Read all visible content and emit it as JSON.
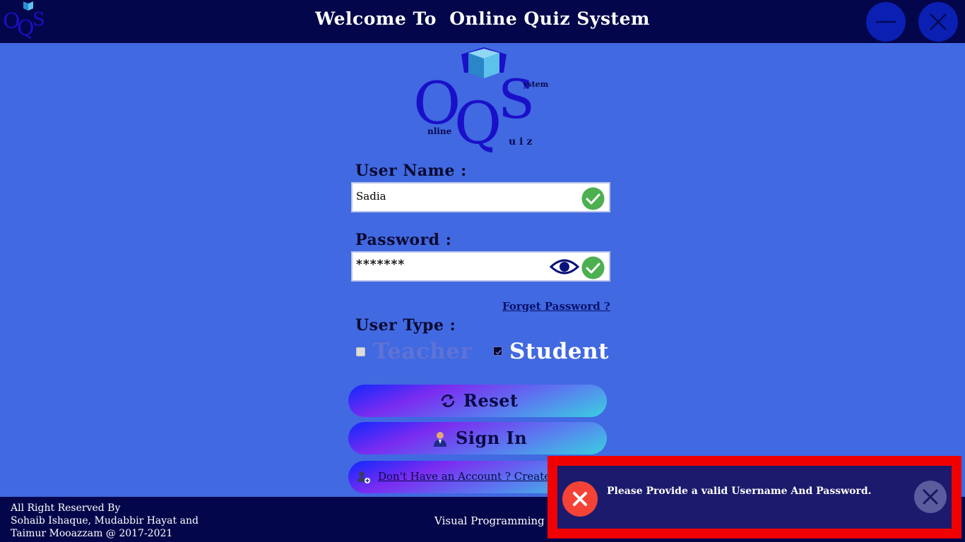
{
  "header": {
    "title": "Welcome To  Online Quiz System",
    "minimize_icon": "minimize-icon",
    "close_icon": "close-icon"
  },
  "logo": {
    "big_letters": [
      "O",
      "Q",
      "S"
    ],
    "nline": "nline",
    "uiz": "uiz",
    "ystem": "ystem"
  },
  "form": {
    "username_label": "User Name :",
    "username_value": "Sadia",
    "password_label": "Password :",
    "password_value": "*******",
    "forget_link": "Forget Password ?",
    "user_type_label": "User Type :",
    "teacher_label": "Teacher",
    "student_label": "Student",
    "teacher_checked": false,
    "student_checked": true
  },
  "buttons": {
    "reset_label": "Reset",
    "signin_label": "Sign In",
    "create_label": "Don't Have an Account ? Create A"
  },
  "footer": {
    "credits_line1": "All Right Reserved By",
    "credits_line2": "Sohaib Ishaque, Mudabbir Hayat and",
    "credits_line3": "Taimur Mooazzam @ 2017-2021",
    "subject": "Visual Programming"
  },
  "toast": {
    "message": "Please Provide a valid Username And Password."
  },
  "colors": {
    "background": "#4169e1",
    "bars": "#03064a",
    "valid_check": "#4caf50",
    "error_red": "#f44336"
  }
}
